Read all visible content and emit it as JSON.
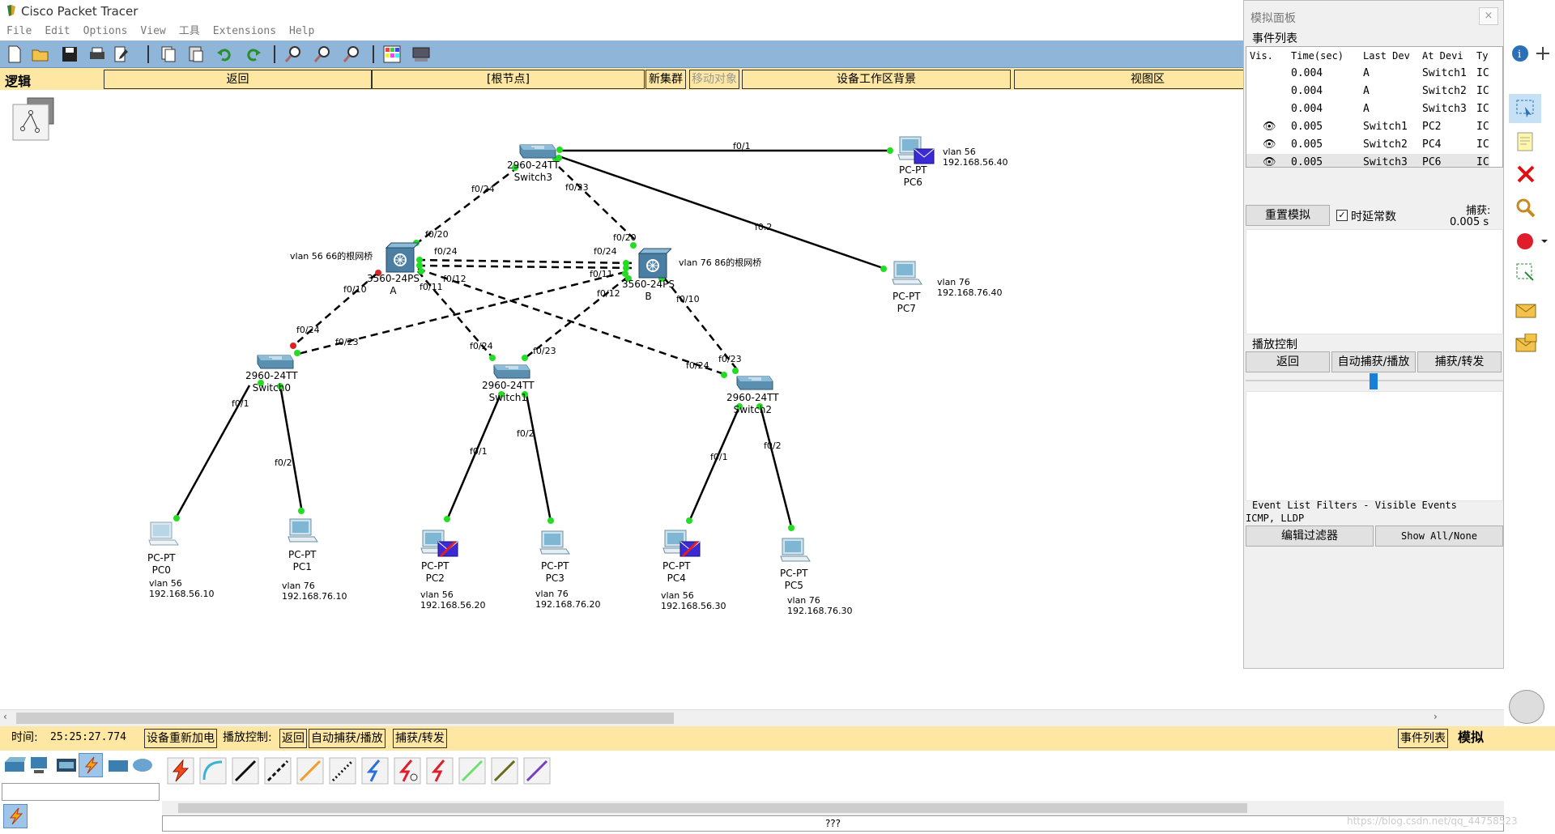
{
  "window": {
    "title": "Cisco Packet Tracer"
  },
  "menu": [
    "File",
    "Edit",
    "Options",
    "View",
    "工具",
    "Extensions",
    "Help"
  ],
  "workspace_bar": {
    "mode": "逻辑",
    "back": "返回",
    "root": "[根节点]",
    "new_cluster": "新集群",
    "move_object": "移动对象",
    "background": "设备工作区背景",
    "viewport": "视图区"
  },
  "topology": {
    "devices": [
      {
        "id": "switch3",
        "model": "2960-24TT",
        "name": "Switch3"
      },
      {
        "id": "multilayer-a",
        "model": "3560-24PS",
        "name": "A",
        "note": "vlan 56 66的根网桥"
      },
      {
        "id": "multilayer-b",
        "model": "3560-24PS",
        "name": "B",
        "note": "vlan 76 86的根网桥"
      },
      {
        "id": "switch0",
        "model": "2960-24TT",
        "name": "Switch0"
      },
      {
        "id": "switch1",
        "model": "2960-24TT",
        "name": "Switch1"
      },
      {
        "id": "switch2",
        "model": "2960-24TT",
        "name": "Switch2"
      },
      {
        "id": "pc6",
        "model": "PC-PT",
        "name": "PC6",
        "vlan": "vlan 56",
        "ip": "192.168.56.40"
      },
      {
        "id": "pc7",
        "model": "PC-PT",
        "name": "PC7",
        "vlan": "vlan 76",
        "ip": "192.168.76.40"
      },
      {
        "id": "pc0",
        "model": "PC-PT",
        "name": "PC0",
        "vlan": "vlan 56",
        "ip": "192.168.56.10"
      },
      {
        "id": "pc1",
        "model": "PC-PT",
        "name": "PC1",
        "vlan": "vlan 76",
        "ip": "192.168.76.10"
      },
      {
        "id": "pc2",
        "model": "PC-PT",
        "name": "PC2",
        "vlan": "vlan 56",
        "ip": "192.168.56.20"
      },
      {
        "id": "pc3",
        "model": "PC-PT",
        "name": "PC3",
        "vlan": "vlan 76",
        "ip": "192.168.76.20"
      },
      {
        "id": "pc4",
        "model": "PC-PT",
        "name": "PC4",
        "vlan": "vlan 56",
        "ip": "192.168.56.30"
      },
      {
        "id": "pc5",
        "model": "PC-PT",
        "name": "PC5",
        "vlan": "vlan 76",
        "ip": "192.168.76.30"
      }
    ],
    "port_labels": {
      "sw3_pc6": "f0/1",
      "sw3_pc7": "f0.2",
      "sw3_a": "f0/24",
      "sw3_b": "f0/23",
      "a_sw3": "f0/20",
      "b_sw3": "f0/20",
      "a_b": "f0/24",
      "b_a": "f0/24",
      "a_sw0": "f0/10",
      "a_sw1": "f0/11",
      "a_sw2": "f0/12",
      "b_sw0": "f0/11",
      "b_sw1": "f0/12",
      "b_sw2": "f0/10",
      "sw0_a": "f0/24",
      "sw0_b": "f0/23",
      "sw1_a": "f0/24",
      "sw1_b": "f0/23",
      "sw2_a": "f0/24",
      "sw2_b": "f0/23",
      "sw0_pc0": "f0/1",
      "sw0_pc1": "f0/2",
      "sw1_pc2": "f0/1",
      "sw1_pc3": "f0/2",
      "sw2_pc4": "f0/1",
      "sw2_pc5": "f0/2"
    }
  },
  "sim_panel": {
    "title": "模拟面板",
    "event_list_title": "事件列表",
    "columns": [
      "Vis.",
      "Time(sec)",
      "Last Dev",
      "At Devi",
      "Ty"
    ],
    "events": [
      {
        "visible": false,
        "time": "0.004",
        "last": "A",
        "at": "Switch1",
        "type": "IC"
      },
      {
        "visible": false,
        "time": "0.004",
        "last": "A",
        "at": "Switch2",
        "type": "IC"
      },
      {
        "visible": false,
        "time": "0.004",
        "last": "A",
        "at": "Switch3",
        "type": "IC"
      },
      {
        "visible": true,
        "time": "0.005",
        "last": "Switch1",
        "at": "PC2",
        "type": "IC"
      },
      {
        "visible": true,
        "time": "0.005",
        "last": "Switch2",
        "at": "PC4",
        "type": "IC"
      },
      {
        "visible": true,
        "time": "0.005",
        "last": "Switch3",
        "at": "PC6",
        "type": "IC"
      }
    ],
    "reset": "重置模拟",
    "constant_delay": "时延常数",
    "constant_delay_checked": true,
    "capture_label": "捕获:",
    "capture_value": "0.005 s",
    "play_title": "播放控制",
    "play_back": "返回",
    "auto_capture": "自动捕获/播放",
    "capture_forward": "捕获/转发",
    "filters_title": "Event List Filters - Visible Events",
    "filters_value": "ICMP, LLDP",
    "edit_filters": "编辑过滤器",
    "show_all": "Show All/None"
  },
  "status": {
    "time_label": "时间:",
    "time_value": "25:25:27.774",
    "power_cycle": "设备重新加电",
    "play_label": "播放控制:",
    "back": "返回",
    "auto": "自动捕获/播放",
    "forward": "捕获/转发",
    "event_list": "事件列表",
    "mode": "模拟"
  },
  "bottom": {
    "device_name": "???",
    "watermark": "https://blog.csdn.net/qq_44758523"
  },
  "colors": {
    "toolbar": "#8fb6d9",
    "yellow": "#fde7a2",
    "link_up": "#00dd00",
    "link_down": "#dd0000"
  }
}
